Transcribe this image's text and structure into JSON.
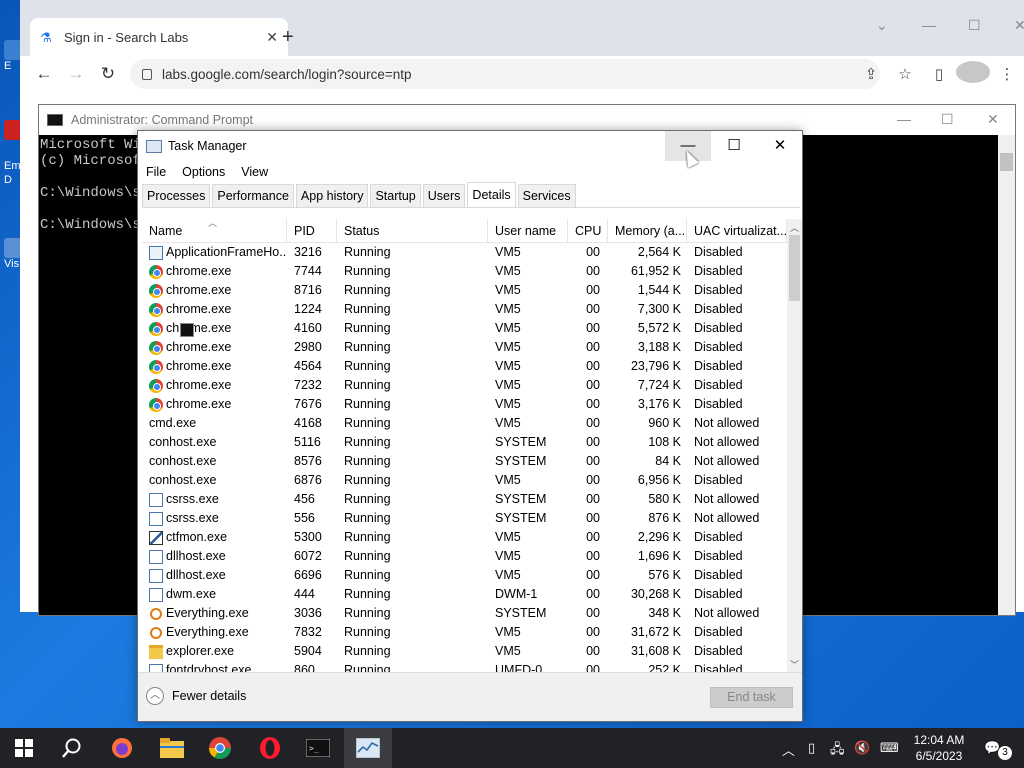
{
  "desktop": {
    "labels": [
      "E",
      "Em",
      "D",
      "Vis"
    ]
  },
  "browser": {
    "tab_title": "Sign in - Search Labs",
    "new_tab": "+",
    "url": "labs.google.com/search/login?source=ntp"
  },
  "cmd": {
    "title": "Administrator: Command Prompt",
    "lines": [
      "Microsoft Wi",
      "(c) Microsof",
      "",
      "C:\\Windows\\sy",
      "",
      "C:\\Windows\\sy"
    ]
  },
  "taskmanager": {
    "title": "Task Manager",
    "menu": [
      "File",
      "Options",
      "View"
    ],
    "tabs": [
      "Processes",
      "Performance",
      "App history",
      "Startup",
      "Users",
      "Details",
      "Services"
    ],
    "active_tab": "Details",
    "columns": [
      "Name",
      "PID",
      "Status",
      "User name",
      "CPU",
      "Memory (a...",
      "UAC virtualizat..."
    ],
    "rows": [
      {
        "icon": "app",
        "name": "ApplicationFrameHo...",
        "pid": "3216",
        "status": "Running",
        "user": "VM5",
        "cpu": "00",
        "mem": "2,564 K",
        "uac": "Disabled"
      },
      {
        "icon": "chrome",
        "name": "chrome.exe",
        "pid": "7744",
        "status": "Running",
        "user": "VM5",
        "cpu": "00",
        "mem": "61,952 K",
        "uac": "Disabled"
      },
      {
        "icon": "chrome",
        "name": "chrome.exe",
        "pid": "8716",
        "status": "Running",
        "user": "VM5",
        "cpu": "00",
        "mem": "1,544 K",
        "uac": "Disabled"
      },
      {
        "icon": "chrome",
        "name": "chrome.exe",
        "pid": "1224",
        "status": "Running",
        "user": "VM5",
        "cpu": "00",
        "mem": "7,300 K",
        "uac": "Disabled"
      },
      {
        "icon": "chrome",
        "name": "chrome.exe",
        "pid": "4160",
        "status": "Running",
        "user": "VM5",
        "cpu": "00",
        "mem": "5,572 K",
        "uac": "Disabled"
      },
      {
        "icon": "chrome",
        "name": "chrome.exe",
        "pid": "2980",
        "status": "Running",
        "user": "VM5",
        "cpu": "00",
        "mem": "3,188 K",
        "uac": "Disabled"
      },
      {
        "icon": "chrome",
        "name": "chrome.exe",
        "pid": "4564",
        "status": "Running",
        "user": "VM5",
        "cpu": "00",
        "mem": "23,796 K",
        "uac": "Disabled"
      },
      {
        "icon": "chrome",
        "name": "chrome.exe",
        "pid": "7232",
        "status": "Running",
        "user": "VM5",
        "cpu": "00",
        "mem": "7,724 K",
        "uac": "Disabled"
      },
      {
        "icon": "chrome",
        "name": "chrome.exe",
        "pid": "7676",
        "status": "Running",
        "user": "VM5",
        "cpu": "00",
        "mem": "3,176 K",
        "uac": "Disabled"
      },
      {
        "icon": "cmd",
        "name": "cmd.exe",
        "pid": "4168",
        "status": "Running",
        "user": "VM5",
        "cpu": "00",
        "mem": "960 K",
        "uac": "Not allowed"
      },
      {
        "icon": "cmd",
        "name": "conhost.exe",
        "pid": "5116",
        "status": "Running",
        "user": "SYSTEM",
        "cpu": "00",
        "mem": "108 K",
        "uac": "Not allowed"
      },
      {
        "icon": "cmd",
        "name": "conhost.exe",
        "pid": "8576",
        "status": "Running",
        "user": "SYSTEM",
        "cpu": "00",
        "mem": "84 K",
        "uac": "Not allowed"
      },
      {
        "icon": "cmd",
        "name": "conhost.exe",
        "pid": "6876",
        "status": "Running",
        "user": "VM5",
        "cpu": "00",
        "mem": "6,956 K",
        "uac": "Disabled"
      },
      {
        "icon": "sys",
        "name": "csrss.exe",
        "pid": "456",
        "status": "Running",
        "user": "SYSTEM",
        "cpu": "00",
        "mem": "580 K",
        "uac": "Not allowed"
      },
      {
        "icon": "sys",
        "name": "csrss.exe",
        "pid": "556",
        "status": "Running",
        "user": "SYSTEM",
        "cpu": "00",
        "mem": "876 K",
        "uac": "Not allowed"
      },
      {
        "icon": "pen",
        "name": "ctfmon.exe",
        "pid": "5300",
        "status": "Running",
        "user": "VM5",
        "cpu": "00",
        "mem": "2,296 K",
        "uac": "Disabled"
      },
      {
        "icon": "sys",
        "name": "dllhost.exe",
        "pid": "6072",
        "status": "Running",
        "user": "VM5",
        "cpu": "00",
        "mem": "1,696 K",
        "uac": "Disabled"
      },
      {
        "icon": "sys",
        "name": "dllhost.exe",
        "pid": "6696",
        "status": "Running",
        "user": "VM5",
        "cpu": "00",
        "mem": "576 K",
        "uac": "Disabled"
      },
      {
        "icon": "sys",
        "name": "dwm.exe",
        "pid": "444",
        "status": "Running",
        "user": "DWM-1",
        "cpu": "00",
        "mem": "30,268 K",
        "uac": "Disabled"
      },
      {
        "icon": "every",
        "name": "Everything.exe",
        "pid": "3036",
        "status": "Running",
        "user": "SYSTEM",
        "cpu": "00",
        "mem": "348 K",
        "uac": "Not allowed"
      },
      {
        "icon": "every",
        "name": "Everything.exe",
        "pid": "7832",
        "status": "Running",
        "user": "VM5",
        "cpu": "00",
        "mem": "31,672 K",
        "uac": "Disabled"
      },
      {
        "icon": "folder",
        "name": "explorer.exe",
        "pid": "5904",
        "status": "Running",
        "user": "VM5",
        "cpu": "00",
        "mem": "31,608 K",
        "uac": "Disabled"
      },
      {
        "icon": "sys",
        "name": "fontdrvhost.exe",
        "pid": "860",
        "status": "Running",
        "user": "UMFD-0",
        "cpu": "00",
        "mem": "252 K",
        "uac": "Disabled"
      }
    ],
    "fewer_details": "Fewer details",
    "end_task": "End task"
  },
  "taskbar": {
    "time": "12:04 AM",
    "date": "6/5/2023",
    "notifications": "3"
  }
}
